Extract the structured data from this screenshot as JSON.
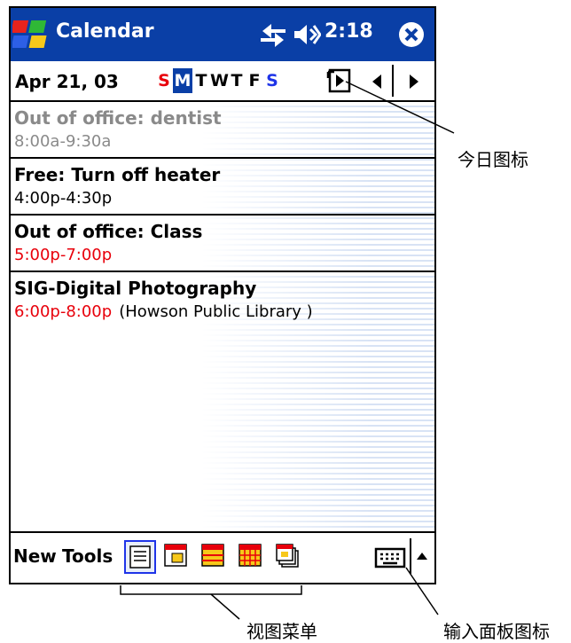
{
  "title_bar": {
    "app_title": "Calendar",
    "clock": "2:18",
    "icons": [
      "windows-start-icon",
      "connectivity-icon",
      "volume-icon",
      "close-icon"
    ]
  },
  "date_bar": {
    "date": "Apr 21, 03",
    "days": [
      "S",
      "M",
      "T",
      "W",
      "T",
      "F",
      "S"
    ],
    "selected_day": "M",
    "icons": [
      "today-icon",
      "previous-arrow-icon",
      "next-arrow-icon"
    ]
  },
  "appointments": [
    {
      "title": "Out of office: dentist",
      "time": "8:00a-9:30a",
      "location": "",
      "past": true
    },
    {
      "title": "Free: Turn off heater",
      "time": "4:00p-4:30p",
      "location": "",
      "past": false
    },
    {
      "title": "Out of office: Class",
      "time": "5:00p-7:00p",
      "location": "",
      "past": false
    },
    {
      "title": "SIG-Digital Photography",
      "time": "6:00p-8:00p",
      "location": "(Howson Public Library )",
      "past": false
    }
  ],
  "command_bar": {
    "new_label": "New",
    "tools_label": "Tools",
    "view_icons": [
      "agenda-view-icon",
      "day-view-icon",
      "week-view-icon",
      "month-view-icon",
      "year-view-icon"
    ],
    "keyboard_icon": "keyboard-icon",
    "sip_arrow_icon": "input-panel-up-arrow-icon"
  },
  "callouts": {
    "today_icon": "今日图标",
    "view_menu": "视图菜单",
    "input_panel_icon": "输入面板图标"
  },
  "colors": {
    "title_bar": "#0a3fa6",
    "conflict_time": "#e8000b",
    "past_item": "#8a8a8a",
    "saturday": "#1e34e8",
    "sunday": "#e8000b"
  }
}
